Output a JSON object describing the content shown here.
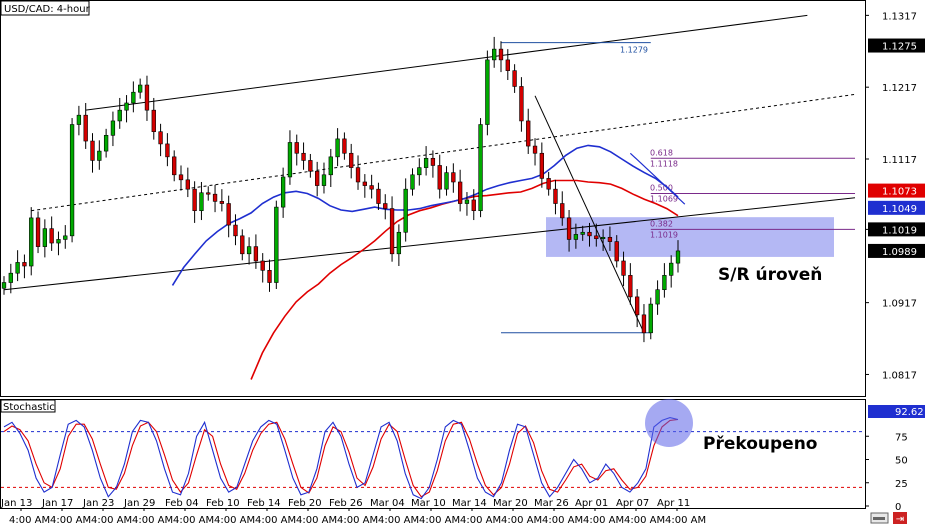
{
  "chart_data": [
    {
      "type": "candlestick",
      "title": "USD/CAD: 4-hour",
      "ylim": [
        1.0787,
        1.1337
      ],
      "y_ticks": [
        "1.1317",
        "1.1217",
        "1.1117",
        "1.1019",
        "1.0917",
        "1.0817"
      ],
      "price_labels": [
        {
          "text": "1.1275",
          "value": 1.1275,
          "bg": "#000000",
          "fg": "#ffffff"
        },
        {
          "text": "1.1073",
          "value": 1.1073,
          "bg": "#e00000",
          "fg": "#ffffff"
        },
        {
          "text": "1.1049",
          "value": 1.1049,
          "bg": "#1f2fd0",
          "fg": "#ffffff"
        },
        {
          "text": "1.1019",
          "value": 1.1019,
          "bg": "#000000",
          "fg": "#ffffff"
        },
        {
          "text": "1.0989",
          "value": 1.0989,
          "bg": "#000000",
          "fg": "#ffffff"
        }
      ],
      "x_ticks": [
        "Jan 13 4:00 AM",
        "Jan 17 4:00 AM",
        "Jan 23 4:00 AM",
        "Jan 29 4:00 AM",
        "Feb 04 4:00 AM",
        "Feb 10 4:00 AM",
        "Feb 14 4:00 AM",
        "Feb 20 4:00 AM",
        "Feb 26 4:00 AM",
        "Mar 04 4:00 AM",
        "Mar 10 4:00 AM",
        "Mar 14 4:00 AM",
        "Mar 20 4:00 AM",
        "Mar 26 4:00 AM",
        "Apr 01 4:00 AM",
        "Apr 07 4:00 AM",
        "Apr 11 4:00 AM"
      ],
      "series": [
        {
          "name": "Price",
          "color": "#000000",
          "values": [
            1.0945,
            1.0958,
            1.0973,
            1.0968,
            1.1035,
            1.0995,
            1.102,
            1.1,
            1.1005,
            1.101,
            1.1165,
            1.1178,
            1.1142,
            1.1115,
            1.1128,
            1.115,
            1.117,
            1.1185,
            1.1195,
            1.121,
            1.122,
            1.1185,
            1.1155,
            1.1138,
            1.112,
            1.1095,
            1.1088,
            1.1075,
            1.1045,
            1.107,
            1.1068,
            1.1058,
            1.1055,
            1.1025,
            1.101,
            1.0985,
            1.0995,
            1.0975,
            1.0962,
            1.0945,
            1.105,
            1.1092,
            1.114,
            1.1125,
            1.1115,
            1.11,
            1.108,
            1.1095,
            1.112,
            1.1145,
            1.1125,
            1.1105,
            1.1085,
            1.108,
            1.1075,
            1.1055,
            1.1048,
            1.0985,
            1.1015,
            1.1075,
            1.1095,
            1.1105,
            1.1118,
            1.1108,
            1.1075,
            1.1098,
            1.1085,
            1.1055,
            1.106,
            1.1045,
            1.1165,
            1.1255,
            1.127,
            1.1255,
            1.124,
            1.1218,
            1.117,
            1.1135,
            1.1125,
            1.109,
            1.1075,
            1.1055,
            1.1035,
            1.1005,
            1.1012,
            1.1015,
            1.101,
            1.1006,
            1.1008,
            1.1002,
            1.0975,
            1.0955,
            1.0925,
            1.09,
            1.0875,
            1.0915,
            1.0935,
            1.0955,
            1.0972,
            1.0989
          ]
        },
        {
          "name": "MA blue",
          "color": "#1f2fd0",
          "values": [
            null,
            null,
            null,
            null,
            null,
            null,
            null,
            null,
            null,
            null,
            null,
            null,
            null,
            null,
            null,
            1.0941,
            1.0966,
            1.0985,
            1.1003,
            1.1016,
            1.1027,
            1.1034,
            1.1042,
            1.1055,
            1.1064,
            1.107,
            1.1072,
            1.1069,
            1.1062,
            1.1052,
            1.1046,
            1.1044,
            1.1047,
            1.105,
            1.1047,
            1.1046,
            1.1046,
            1.1048,
            1.1052,
            1.1055,
            1.1058,
            1.1062,
            1.1068,
            1.1075,
            1.108,
            1.1084,
            1.1087,
            1.109,
            1.1096,
            1.1108,
            1.1122,
            1.1132,
            1.1136,
            1.1134,
            1.1127,
            1.1117,
            1.1107,
            1.1098,
            1.109,
            1.1078,
            1.1064
          ]
        },
        {
          "name": "MA red",
          "color": "#e00000",
          "values": [
            null,
            null,
            null,
            null,
            null,
            null,
            null,
            null,
            null,
            null,
            null,
            null,
            null,
            null,
            null,
            null,
            null,
            null,
            null,
            null,
            null,
            null,
            1.081,
            1.0847,
            1.0875,
            1.0898,
            1.0918,
            1.0932,
            1.0943,
            1.0958,
            1.097,
            1.098,
            1.0991,
            1.1003,
            1.1017,
            1.103,
            1.1039,
            1.1045,
            1.1049,
            1.1054,
            1.1058,
            1.1062,
            1.1065,
            1.1066,
            1.1068,
            1.107,
            1.1071,
            1.1076,
            1.1083,
            1.1087,
            1.1087,
            1.1087,
            1.1085,
            1.1084,
            1.1082,
            1.1076,
            1.1068,
            1.1061,
            1.1055,
            1.1048,
            1.1038
          ]
        }
      ],
      "annotations": [
        {
          "text": "1.1279"
        },
        {
          "text": "0.618"
        },
        {
          "text": "1.1118"
        },
        {
          "text": "0.500"
        },
        {
          "text": "1.1069"
        },
        {
          "text": "0.382"
        },
        {
          "text": "1.1019"
        },
        {
          "text": "S/R úroveň"
        }
      ]
    },
    {
      "type": "line",
      "title": "Stochastic",
      "ylim": [
        0,
        100
      ],
      "y_ticks": [
        "75",
        "50",
        "25",
        "0"
      ],
      "levels": [
        80,
        20
      ],
      "current_label": "92.62",
      "series": [
        {
          "name": "%K",
          "color": "#1f2fd0",
          "values": [
            85,
            90,
            78,
            60,
            30,
            15,
            20,
            55,
            88,
            92,
            85,
            60,
            30,
            10,
            20,
            45,
            80,
            92,
            90,
            70,
            40,
            15,
            12,
            35,
            75,
            90,
            60,
            30,
            15,
            20,
            45,
            70,
            85,
            92,
            88,
            60,
            30,
            12,
            15,
            40,
            80,
            90,
            75,
            45,
            20,
            25,
            55,
            85,
            90,
            70,
            35,
            12,
            8,
            20,
            50,
            85,
            92,
            88,
            60,
            30,
            15,
            10,
            25,
            60,
            88,
            85,
            55,
            25,
            10,
            20,
            35,
            50,
            40,
            25,
            30,
            45,
            35,
            20,
            15,
            25,
            40,
            85,
            92,
            95,
            93
          ]
        },
        {
          "name": "%D",
          "color": "#e00000",
          "values": [
            80,
            86,
            82,
            70,
            45,
            25,
            20,
            40,
            75,
            88,
            88,
            72,
            45,
            20,
            18,
            35,
            65,
            86,
            90,
            80,
            55,
            28,
            15,
            25,
            55,
            82,
            75,
            45,
            22,
            18,
            35,
            60,
            78,
            88,
            90,
            72,
            45,
            20,
            14,
            30,
            65,
            85,
            80,
            58,
            30,
            22,
            42,
            72,
            88,
            80,
            50,
            22,
            10,
            15,
            38,
            70,
            88,
            90,
            72,
            45,
            22,
            12,
            20,
            45,
            78,
            86,
            68,
            38,
            18,
            15,
            28,
            42,
            45,
            32,
            28,
            38,
            40,
            28,
            18,
            20,
            32,
            65,
            85,
            92,
            93
          ]
        }
      ],
      "annotations": [
        {
          "text": "Překoupeno"
        }
      ]
    }
  ]
}
